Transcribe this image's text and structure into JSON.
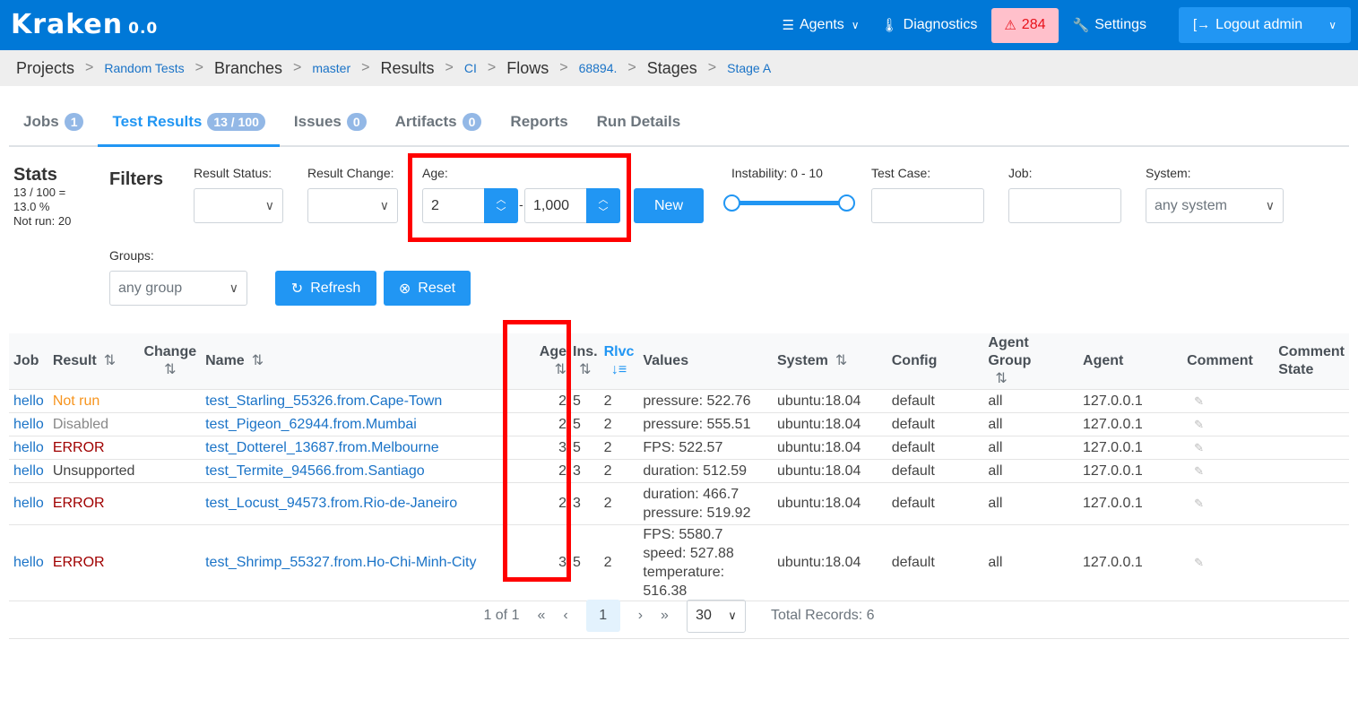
{
  "app": {
    "name": "Kraken",
    "version": "0.0"
  },
  "nav": {
    "agents": "Agents",
    "diagnostics": "Diagnostics",
    "alerts_count": "284",
    "settings": "Settings",
    "logout": "Logout admin"
  },
  "breadcrumb": [
    {
      "label": "Projects",
      "type": "text"
    },
    {
      "label": "Random Tests",
      "type": "link"
    },
    {
      "label": "Branches",
      "type": "text"
    },
    {
      "label": "master",
      "type": "link"
    },
    {
      "label": "Results",
      "type": "text"
    },
    {
      "label": "CI",
      "type": "link"
    },
    {
      "label": "Flows",
      "type": "text"
    },
    {
      "label": "68894.",
      "type": "link"
    },
    {
      "label": "Stages",
      "type": "text"
    },
    {
      "label": "Stage A",
      "type": "link"
    }
  ],
  "tabs": [
    {
      "label": "Jobs",
      "badge": "1"
    },
    {
      "label": "Test Results",
      "badge": "13 / 100",
      "active": true
    },
    {
      "label": "Issues",
      "badge": "0"
    },
    {
      "label": "Artifacts",
      "badge": "0"
    },
    {
      "label": "Reports"
    },
    {
      "label": "Run Details"
    }
  ],
  "stats": {
    "title": "Stats",
    "line1": "13 / 100 =",
    "line2": "13.0 %",
    "line3": "Not run: 20"
  },
  "filters": {
    "title": "Filters",
    "result_status_label": "Result Status:",
    "result_change_label": "Result Change:",
    "age_label": "Age:",
    "age_min": "2",
    "age_max": "1,000",
    "age_sep": "-",
    "new_button": "New",
    "instability_label": "Instability: 0 - 10",
    "instability_min": 0,
    "instability_max": 10,
    "test_case_label": "Test Case:",
    "job_label": "Job:",
    "system_label": "System:",
    "system_value": "any system",
    "groups_label": "Groups:",
    "groups_value": "any group",
    "refresh_button": "Refresh",
    "reset_button": "Reset"
  },
  "table": {
    "headers": [
      "Job",
      "Result",
      "Change",
      "Name",
      "Age",
      "Ins.",
      "Rlvc",
      "Values",
      "System",
      "Config",
      "Agent Group",
      "Agent",
      "Comment",
      "Comment State"
    ],
    "rows": [
      {
        "job": "hello",
        "result": "Not run",
        "status": "notrun",
        "name": "test_Starling_55326.from.Cape-Town",
        "age": "2",
        "ins": "5",
        "rlvc": "2",
        "values": [
          "pressure: 522.76"
        ],
        "system": "ubuntu:18.04",
        "config": "default",
        "agent_group": "all",
        "agent": "127.0.0.1"
      },
      {
        "job": "hello",
        "result": "Disabled",
        "status": "disabled",
        "name": "test_Pigeon_62944.from.Mumbai",
        "age": "2",
        "ins": "5",
        "rlvc": "2",
        "values": [
          "pressure: 555.51"
        ],
        "system": "ubuntu:18.04",
        "config": "default",
        "agent_group": "all",
        "agent": "127.0.0.1"
      },
      {
        "job": "hello",
        "result": "ERROR",
        "status": "error",
        "name": "test_Dotterel_13687.from.Melbourne",
        "age": "3",
        "ins": "5",
        "rlvc": "2",
        "values": [
          "FPS: 522.57"
        ],
        "system": "ubuntu:18.04",
        "config": "default",
        "agent_group": "all",
        "agent": "127.0.0.1"
      },
      {
        "job": "hello",
        "result": "Unsupported",
        "status": "unsup",
        "name": "test_Termite_94566.from.Santiago",
        "age": "2",
        "ins": "3",
        "rlvc": "2",
        "values": [
          "duration: 512.59"
        ],
        "system": "ubuntu:18.04",
        "config": "default",
        "agent_group": "all",
        "agent": "127.0.0.1"
      },
      {
        "job": "hello",
        "result": "ERROR",
        "status": "error",
        "name": "test_Locust_94573.from.Rio-de-Janeiro",
        "age": "2",
        "ins": "3",
        "rlvc": "2",
        "values": [
          "duration: 466.7",
          "pressure: 519.92"
        ],
        "system": "ubuntu:18.04",
        "config": "default",
        "agent_group": "all",
        "agent": "127.0.0.1"
      },
      {
        "job": "hello",
        "result": "ERROR",
        "status": "error",
        "name": "test_Shrimp_55327.from.Ho-Chi-Minh-City",
        "age": "3",
        "ins": "5",
        "rlvc": "2",
        "values": [
          "FPS: 5580.7",
          "speed: 527.88",
          "temperature: 516.38"
        ],
        "system": "ubuntu:18.04",
        "config": "default",
        "agent_group": "all",
        "agent": "127.0.0.1"
      }
    ]
  },
  "pager": {
    "page_info": "1 of 1",
    "current": "1",
    "page_size": "30",
    "total": "Total Records: 6"
  },
  "colors": {
    "brand": "#0078d7",
    "accent": "#2196f3",
    "error": "#a00000",
    "not_run": "#f7941d",
    "highlight": "#ff0000"
  }
}
